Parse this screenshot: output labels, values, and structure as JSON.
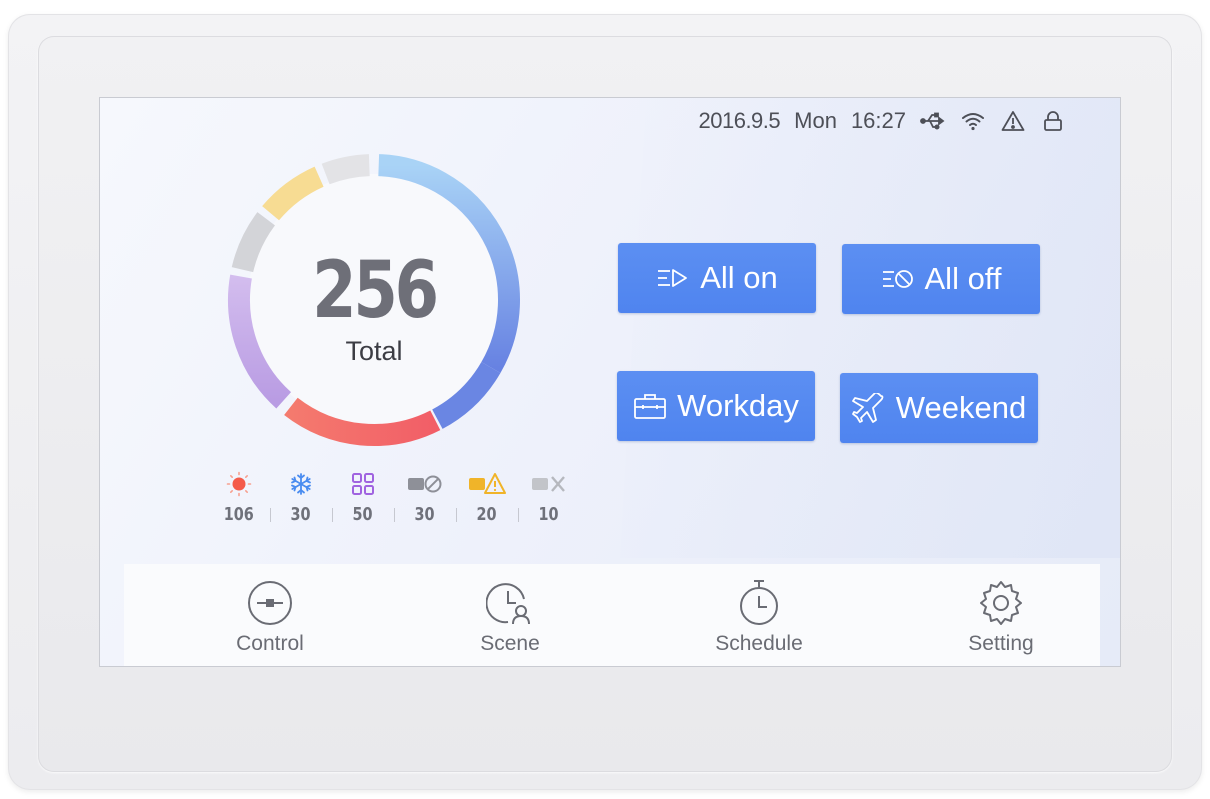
{
  "status": {
    "date": "2016.9.5",
    "weekday": "Mon",
    "time": "16:27",
    "icons": [
      "usb-icon",
      "wifi-icon",
      "warning-icon",
      "lock-icon"
    ]
  },
  "summary": {
    "total_value": "256",
    "total_label": "Total",
    "ring_colors": [
      "#a6cff5",
      "#6a86e3",
      "#f2686a",
      "#c5a8e6",
      "#d3d4d8",
      "#f7dc93",
      "#e3e3e6"
    ]
  },
  "stats": [
    {
      "icon": "sun-icon",
      "value": "106",
      "color": "#f45b4a"
    },
    {
      "icon": "snowflake-icon",
      "value": "30",
      "color": "#4a8cf0"
    },
    {
      "icon": "grid-icon",
      "value": "50",
      "color": "#a063e0"
    },
    {
      "icon": "device-off-icon",
      "value": "30",
      "color": "#8e9098"
    },
    {
      "icon": "device-warning-icon",
      "value": "20",
      "color": "#f0b429"
    },
    {
      "icon": "device-error-icon",
      "value": "10",
      "color": "#b6b8be"
    }
  ],
  "buttons": {
    "all_on": "All on",
    "all_off": "All off",
    "workday": "Workday",
    "weekend": "Weekend"
  },
  "nav": {
    "control": "Control",
    "scene": "Scene",
    "schedule": "Schedule",
    "setting": "Setting"
  },
  "colors": {
    "accent": "#558af0",
    "text": "#3c3d44"
  }
}
